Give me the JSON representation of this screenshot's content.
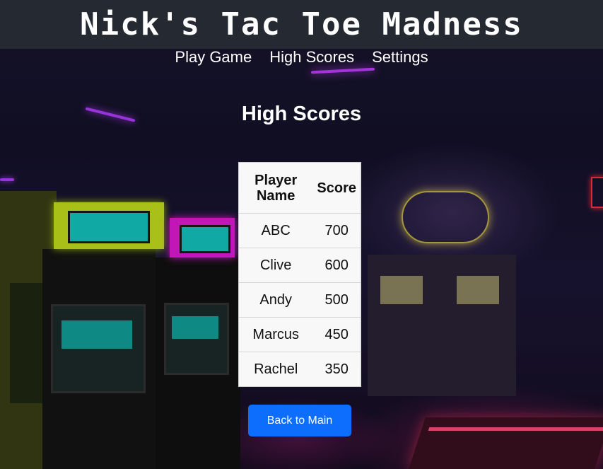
{
  "header": {
    "title": "Nick's Tac Toe Madness"
  },
  "nav": {
    "items": [
      {
        "label": "Play Game"
      },
      {
        "label": "High Scores"
      },
      {
        "label": "Settings"
      }
    ]
  },
  "main": {
    "heading": "High Scores",
    "table": {
      "columns": [
        "Player Name",
        "Score"
      ],
      "rows": [
        {
          "player": "ABC",
          "score": "700"
        },
        {
          "player": "Clive",
          "score": "600"
        },
        {
          "player": "Andy",
          "score": "500"
        },
        {
          "player": "Marcus",
          "score": "450"
        },
        {
          "player": "Rachel",
          "score": "350"
        }
      ]
    },
    "back_button_label": "Back to Main"
  },
  "colors": {
    "header_bg": "#252932",
    "button_bg": "#0d6efd",
    "table_bg": "#f8f8f8"
  }
}
